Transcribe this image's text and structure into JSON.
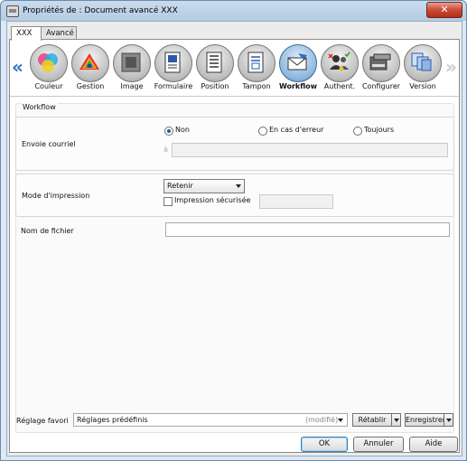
{
  "window": {
    "title": "Propriétés de : Document avancé XXX",
    "close_label": "✕"
  },
  "tabs": [
    {
      "label": "XXX"
    },
    {
      "label": "Avancé"
    }
  ],
  "nav": {
    "prev": "«",
    "next": "»"
  },
  "toolbar": [
    {
      "label": "Couleur",
      "icon": "color-icon"
    },
    {
      "label": "Gestion",
      "icon": "management-icon"
    },
    {
      "label": "Image",
      "icon": "image-icon"
    },
    {
      "label": "Formulaire",
      "icon": "form-icon"
    },
    {
      "label": "Position",
      "icon": "position-icon"
    },
    {
      "label": "Tampon",
      "icon": "stamp-icon"
    },
    {
      "label": "Workflow",
      "icon": "workflow-icon"
    },
    {
      "label": "Authent.",
      "icon": "authentication-icon"
    },
    {
      "label": "Configurer",
      "icon": "configure-icon"
    },
    {
      "label": "Version",
      "icon": "version-icon"
    }
  ],
  "section_title": "Workflow",
  "email": {
    "label": "Envoie courriel",
    "options": [
      "Non",
      "En cas d'erreur",
      "Toujours"
    ],
    "selected": "Non",
    "to_label": "à",
    "to_value": ""
  },
  "print_mode": {
    "label": "Mode d'impression",
    "selected": "Retenir",
    "secure_label": "Impression sécurisée",
    "secure_checked": false,
    "secure_value": ""
  },
  "filename": {
    "label": "Nom de fichier",
    "value": ""
  },
  "favorite": {
    "label": "Réglage favori",
    "value": "Réglages prédéfinis",
    "modified": "(modifié)",
    "reset_label": "Rétablir",
    "save_label": "Enregistrer"
  },
  "buttons": {
    "ok": "OK",
    "cancel": "Annuler",
    "help": "Aide"
  },
  "colors": {
    "accent": "#2a6fc0",
    "selected": "#8cb6dd"
  }
}
